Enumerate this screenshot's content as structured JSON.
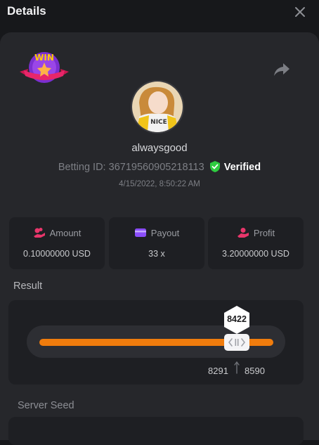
{
  "header": {
    "title": "Details"
  },
  "badge": {
    "text": "WIN"
  },
  "user": {
    "name": "alwaysgood",
    "avatar_text": "NICE",
    "betting_id_label": "Betting ID:",
    "betting_id": "36719560905218113",
    "verified_label": "Verified",
    "timestamp": "4/15/2022, 8:50:22 AM"
  },
  "stats": [
    {
      "label": "Amount",
      "value": "0.10000000 USD",
      "icon": "coins-hand-icon"
    },
    {
      "label": "Payout",
      "value": "33 x",
      "icon": "card-icon"
    },
    {
      "label": "Profit",
      "value": "3.20000000 USD",
      "icon": "profit-hand-icon"
    }
  ],
  "result": {
    "label": "Result",
    "value": "8422",
    "range_low": "8291",
    "range_high": "8590"
  },
  "seed": {
    "label": "Server Seed"
  },
  "colors": {
    "accent": "#f07c0d",
    "verified": "#2ecc40",
    "panel": "#26272b",
    "card": "#1e1f23"
  }
}
